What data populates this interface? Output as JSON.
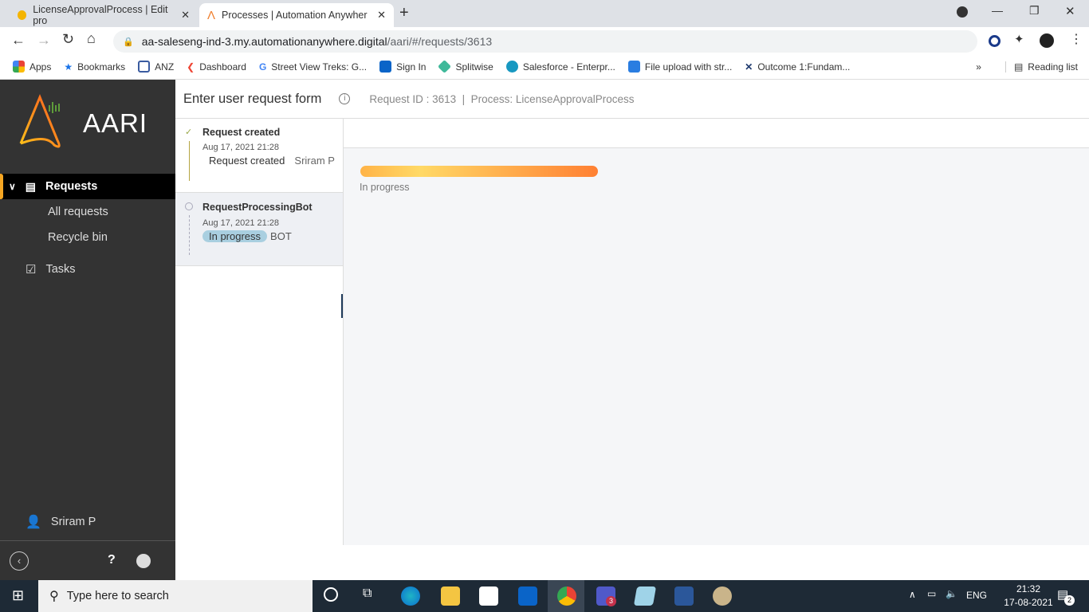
{
  "browser": {
    "tabs": [
      {
        "title": "LicenseApprovalProcess | Edit pro",
        "active": false
      },
      {
        "title": "Processes | Automation Anywher",
        "active": true
      }
    ],
    "url_host": "aa-saleseng-ind-3.my.automationanywhere.digital",
    "url_path": "/aari/#/requests/3613",
    "bookmarks": [
      "Apps",
      "Bookmarks",
      "ANZ",
      "Dashboard",
      "Street View Treks: G...",
      "Sign In",
      "Splitwise",
      "Salesforce - Enterpr...",
      "File upload with str...",
      "Outcome 1:Fundam..."
    ],
    "more": "»",
    "reading_list": "Reading list"
  },
  "sidebar": {
    "brand": "AARI",
    "items": [
      {
        "label": "Requests"
      },
      {
        "label": "All requests"
      },
      {
        "label": "Recycle bin"
      },
      {
        "label": "Tasks"
      }
    ],
    "user": "Sriram P",
    "help": "?"
  },
  "header": {
    "title": "Enter user request form",
    "meta": "Request ID : 3613  |  Process: LicenseApprovalProcess"
  },
  "timeline": [
    {
      "title": "Request created",
      "date": "Aug 17, 2021 21:28",
      "status": "Request created",
      "actor": "Sriram P"
    },
    {
      "title": "RequestProcessingBot",
      "date": "Aug 17, 2021 21:28",
      "status": "In progress",
      "actor": "BOT"
    }
  ],
  "content": {
    "progress_label": "In progress",
    "colors": {
      "start": "#ffb347",
      "mid": "#ffd966",
      "end": "#ff8033"
    }
  },
  "taskbar": {
    "search_placeholder": "Type here to search",
    "time": "21:32",
    "date": "17-08-2021",
    "lang": "ENG",
    "notifications": "2",
    "teams_badge": "3"
  }
}
